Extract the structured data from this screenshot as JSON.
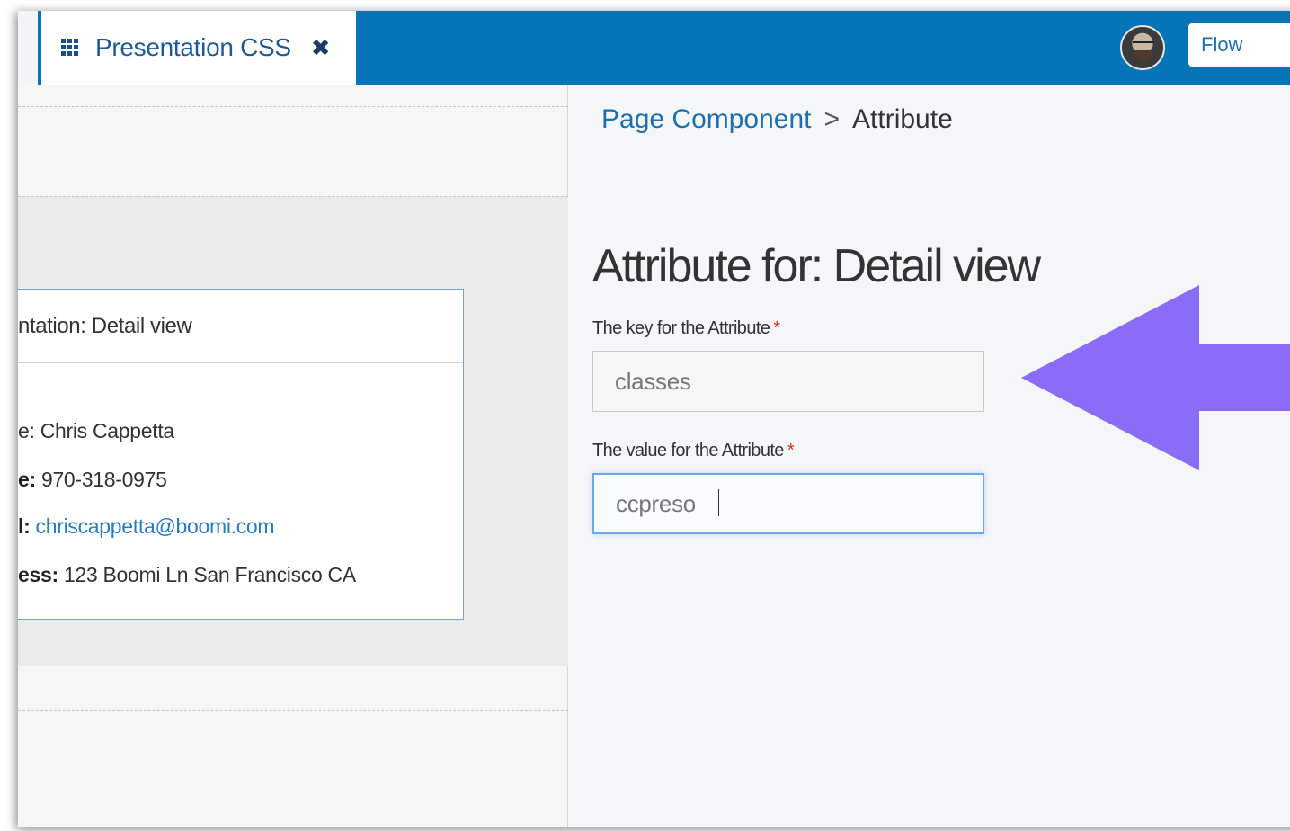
{
  "header": {
    "tab_title": "Presentation CSS",
    "tab_icon": "grid-icon",
    "close_icon": "close-icon",
    "flow_select_value": "Flow",
    "brand_color": "#0575b8"
  },
  "left_panel": {
    "card": {
      "title": "ntation: Detail view",
      "rows": [
        {
          "label": "e:",
          "value": "Chris Cappetta"
        },
        {
          "label": "e:",
          "value": "970-318-0975"
        },
        {
          "label": "l:",
          "value": "chriscappetta@boomi.com"
        },
        {
          "label": "ess:",
          "value": "123 Boomi Ln San Francisco CA"
        }
      ]
    }
  },
  "right_panel": {
    "breadcrumb": {
      "parent": "Page Component",
      "separator": ">",
      "current": "Attribute"
    },
    "heading": "Attribute for: Detail view",
    "fields": [
      {
        "label": "The key for the Attribute",
        "required": "*",
        "value": "classes"
      },
      {
        "label": "The value for the Attribute",
        "required": "*",
        "value": "ccpreso"
      }
    ]
  },
  "annotation": {
    "arrow_color": "#8a6cf7",
    "arrow_direction": "left"
  }
}
